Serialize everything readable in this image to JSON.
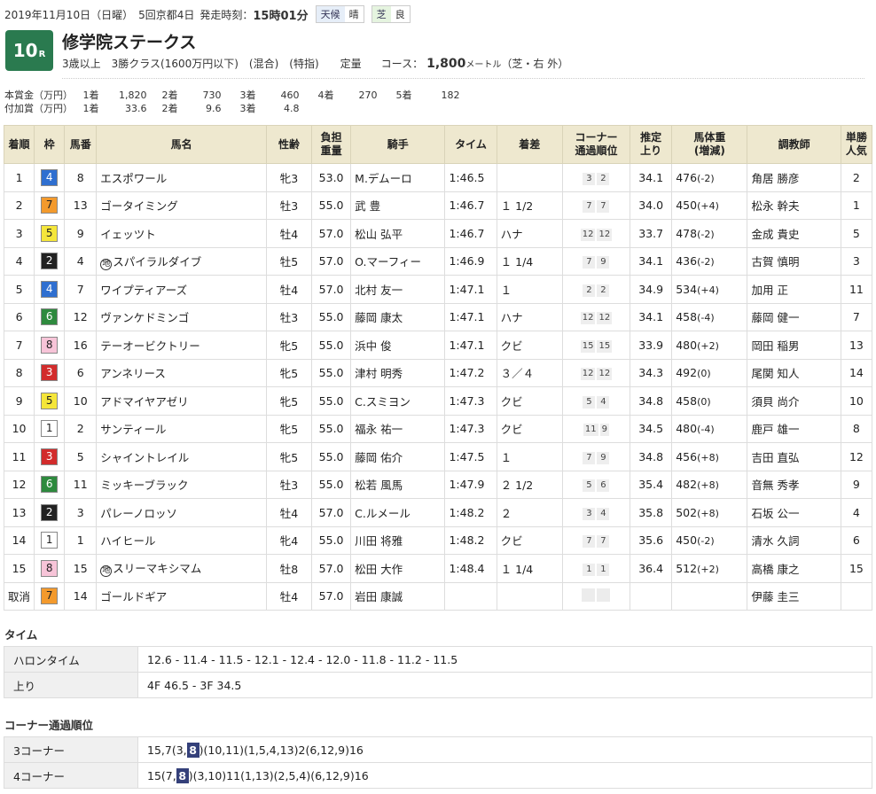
{
  "header": {
    "date": "2019年11月10日（日曜）",
    "meeting": "5回京都4日",
    "post_time_label": "発走時刻：",
    "post_time": "15時01分",
    "weather_label": "天候",
    "weather": "晴",
    "track_label": "芝",
    "track_cond": "良"
  },
  "race": {
    "number": "10",
    "number_suffix": "R",
    "name": "修学院ステークス",
    "conditions": "3歳以上　3勝クラス(1600万円以下)　(混合)　(特指)　　定量",
    "course_label": "コース：",
    "distance": "1,800",
    "distance_unit": "メートル",
    "course_detail": "（芝・右 外）"
  },
  "prize": {
    "main_label": "本賞金（万円）",
    "main": [
      [
        "1着",
        "1,820"
      ],
      [
        "2着",
        "730"
      ],
      [
        "3着",
        "460"
      ],
      [
        "4着",
        "270"
      ],
      [
        "5着",
        "182"
      ]
    ],
    "add_label": "付加賞（万円）",
    "add": [
      [
        "1着",
        "33.6"
      ],
      [
        "2着",
        "9.6"
      ],
      [
        "3着",
        "4.8"
      ]
    ]
  },
  "table": {
    "headers": [
      "着順",
      "枠",
      "馬番",
      "馬名",
      "性齢",
      "負担\n重量",
      "騎手",
      "タイム",
      "着差",
      "コーナー\n通過順位",
      "推定\n上り",
      "馬体重\n(増減)",
      "調教師",
      "単勝\n人気"
    ],
    "rows": [
      {
        "pos": "1",
        "waku": "4",
        "num": "8",
        "mark": "",
        "name": "エスポワール",
        "sexage": "牝3",
        "wt": "53.0",
        "jockey": "M.デムーロ",
        "time": "1:46.5",
        "margin": "",
        "corner": [
          "3",
          "2"
        ],
        "last": "34.1",
        "bw": "476",
        "bwd": "(-2)",
        "trainer": "角居 勝彦",
        "pop": "2"
      },
      {
        "pos": "2",
        "waku": "7",
        "num": "13",
        "mark": "",
        "name": "ゴータイミング",
        "sexage": "牡3",
        "wt": "55.0",
        "jockey": "武 豊",
        "time": "1:46.7",
        "margin": "１ 1/2",
        "corner": [
          "7",
          "7"
        ],
        "last": "34.0",
        "bw": "450",
        "bwd": "(+4)",
        "trainer": "松永 幹夫",
        "pop": "1"
      },
      {
        "pos": "3",
        "waku": "5",
        "num": "9",
        "mark": "",
        "name": "イェッツト",
        "sexage": "牡4",
        "wt": "57.0",
        "jockey": "松山 弘平",
        "time": "1:46.7",
        "margin": "ハナ",
        "corner": [
          "12",
          "12"
        ],
        "last": "33.7",
        "bw": "478",
        "bwd": "(-2)",
        "trainer": "金成 貴史",
        "pop": "5"
      },
      {
        "pos": "4",
        "waku": "2",
        "num": "4",
        "mark": "地",
        "name": "スパイラルダイブ",
        "sexage": "牡5",
        "wt": "57.0",
        "jockey": "O.マーフィー",
        "time": "1:46.9",
        "margin": "１ 1/4",
        "corner": [
          "7",
          "9"
        ],
        "last": "34.1",
        "bw": "436",
        "bwd": "(-2)",
        "trainer": "古賀 慎明",
        "pop": "3"
      },
      {
        "pos": "5",
        "waku": "4",
        "num": "7",
        "mark": "",
        "name": "ワイプティアーズ",
        "sexage": "牡4",
        "wt": "57.0",
        "jockey": "北村 友一",
        "time": "1:47.1",
        "margin": "１",
        "corner": [
          "2",
          "2"
        ],
        "last": "34.9",
        "bw": "534",
        "bwd": "(+4)",
        "trainer": "加用 正",
        "pop": "11"
      },
      {
        "pos": "6",
        "waku": "6",
        "num": "12",
        "mark": "",
        "name": "ヴァンケドミンゴ",
        "sexage": "牡3",
        "wt": "55.0",
        "jockey": "藤岡 康太",
        "time": "1:47.1",
        "margin": "ハナ",
        "corner": [
          "12",
          "12"
        ],
        "last": "34.1",
        "bw": "458",
        "bwd": "(-4)",
        "trainer": "藤岡 健一",
        "pop": "7"
      },
      {
        "pos": "7",
        "waku": "8",
        "num": "16",
        "mark": "",
        "name": "テーオービクトリー",
        "sexage": "牝5",
        "wt": "55.0",
        "jockey": "浜中 俊",
        "time": "1:47.1",
        "margin": "クビ",
        "corner": [
          "15",
          "15"
        ],
        "last": "33.9",
        "bw": "480",
        "bwd": "(+2)",
        "trainer": "岡田 稲男",
        "pop": "13"
      },
      {
        "pos": "8",
        "waku": "3",
        "num": "6",
        "mark": "",
        "name": "アンネリース",
        "sexage": "牝5",
        "wt": "55.0",
        "jockey": "津村 明秀",
        "time": "1:47.2",
        "margin": "３／４",
        "corner": [
          "12",
          "12"
        ],
        "last": "34.3",
        "bw": "492",
        "bwd": "(0)",
        "trainer": "尾関 知人",
        "pop": "14"
      },
      {
        "pos": "9",
        "waku": "5",
        "num": "10",
        "mark": "",
        "name": "アドマイヤアゼリ",
        "sexage": "牝5",
        "wt": "55.0",
        "jockey": "C.スミヨン",
        "time": "1:47.3",
        "margin": "クビ",
        "corner": [
          "5",
          "4"
        ],
        "last": "34.8",
        "bw": "458",
        "bwd": "(0)",
        "trainer": "須貝 尚介",
        "pop": "10"
      },
      {
        "pos": "10",
        "waku": "1",
        "num": "2",
        "mark": "",
        "name": "サンティール",
        "sexage": "牝5",
        "wt": "55.0",
        "jockey": "福永 祐一",
        "time": "1:47.3",
        "margin": "クビ",
        "corner": [
          "11",
          "9"
        ],
        "last": "34.5",
        "bw": "480",
        "bwd": "(-4)",
        "trainer": "鹿戸 雄一",
        "pop": "8"
      },
      {
        "pos": "11",
        "waku": "3",
        "num": "5",
        "mark": "",
        "name": "シャイントレイル",
        "sexage": "牝5",
        "wt": "55.0",
        "jockey": "藤岡 佑介",
        "time": "1:47.5",
        "margin": "１",
        "corner": [
          "7",
          "9"
        ],
        "last": "34.8",
        "bw": "456",
        "bwd": "(+8)",
        "trainer": "吉田 直弘",
        "pop": "12"
      },
      {
        "pos": "12",
        "waku": "6",
        "num": "11",
        "mark": "",
        "name": "ミッキーブラック",
        "sexage": "牡3",
        "wt": "55.0",
        "jockey": "松若 風馬",
        "time": "1:47.9",
        "margin": "２ 1/2",
        "corner": [
          "5",
          "6"
        ],
        "last": "35.4",
        "bw": "482",
        "bwd": "(+8)",
        "trainer": "音無 秀孝",
        "pop": "9"
      },
      {
        "pos": "13",
        "waku": "2",
        "num": "3",
        "mark": "",
        "name": "パレーノロッソ",
        "sexage": "牡4",
        "wt": "57.0",
        "jockey": "C.ルメール",
        "time": "1:48.2",
        "margin": "２",
        "corner": [
          "3",
          "4"
        ],
        "last": "35.8",
        "bw": "502",
        "bwd": "(+8)",
        "trainer": "石坂 公一",
        "pop": "4"
      },
      {
        "pos": "14",
        "waku": "1",
        "num": "1",
        "mark": "",
        "name": "ハイヒール",
        "sexage": "牝4",
        "wt": "55.0",
        "jockey": "川田 将雅",
        "time": "1:48.2",
        "margin": "クビ",
        "corner": [
          "7",
          "7"
        ],
        "last": "35.6",
        "bw": "450",
        "bwd": "(-2)",
        "trainer": "清水 久詞",
        "pop": "6"
      },
      {
        "pos": "15",
        "waku": "8",
        "num": "15",
        "mark": "地",
        "name": "スリーマキシマム",
        "sexage": "牡8",
        "wt": "57.0",
        "jockey": "松田 大作",
        "time": "1:48.4",
        "margin": "１ 1/4",
        "corner": [
          "1",
          "1"
        ],
        "last": "36.4",
        "bw": "512",
        "bwd": "(+2)",
        "trainer": "高橋 康之",
        "pop": "15"
      },
      {
        "pos": "取消",
        "waku": "7",
        "num": "14",
        "mark": "",
        "name": "ゴールドギア",
        "sexage": "牡4",
        "wt": "57.0",
        "jockey": "岩田 康誠",
        "time": "",
        "margin": "",
        "corner": [
          "",
          ""
        ],
        "last": "",
        "bw": "",
        "bwd": "",
        "trainer": "伊藤 圭三",
        "pop": ""
      }
    ]
  },
  "waku_colors": {
    "1": {
      "bg": "#ffffff",
      "fg": "#222222"
    },
    "2": {
      "bg": "#222222",
      "fg": "#ffffff"
    },
    "3": {
      "bg": "#d22c2c",
      "fg": "#ffffff"
    },
    "4": {
      "bg": "#2f6fd0",
      "fg": "#ffffff"
    },
    "5": {
      "bg": "#f5e63a",
      "fg": "#222222"
    },
    "6": {
      "bg": "#2e8a3e",
      "fg": "#ffffff"
    },
    "7": {
      "bg": "#f39a2d",
      "fg": "#222222"
    },
    "8": {
      "bg": "#f7c4d8",
      "fg": "#222222"
    }
  },
  "time_section": {
    "title": "タイム",
    "furlong_label": "ハロンタイム",
    "furlong": "12.6 - 11.4 - 11.5 - 12.1 - 12.4 - 12.0 - 11.8 - 11.2 - 11.5",
    "final_label": "上り",
    "final": "4F 46.5 - 3F 34.5"
  },
  "corner_section": {
    "title": "コーナー通過順位",
    "c3_label": "3コーナー",
    "c3_pre": "15,7(3,",
    "c3_hl": "8",
    "c3_post": ")(10,11)(1,5,4,13)2(6,12,9)16",
    "c4_label": "4コーナー",
    "c4_pre": "15(7,",
    "c4_hl": "8",
    "c4_post": ")(3,10)11(1,13)(2,5,4)(6,12,9)16"
  }
}
